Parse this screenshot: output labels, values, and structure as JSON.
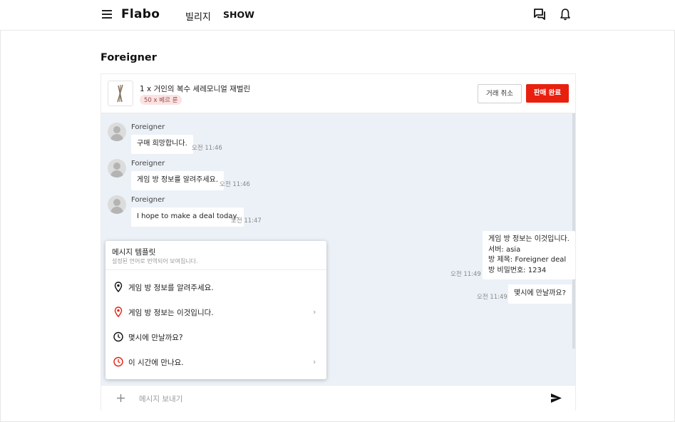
{
  "header": {
    "logo": "Flabo",
    "nav": [
      "빌리지",
      "SHOW"
    ]
  },
  "page": {
    "title": "Foreigner"
  },
  "product": {
    "name": "1 x 거인의 복수 세레모니얼 재벌린",
    "price_badge": "50 x 베르 룬",
    "cancel_label": "거래 취소",
    "complete_label": "판매 완료"
  },
  "messages": [
    {
      "sender": "Foreigner",
      "text": "구매 희망합니다.",
      "time": "오전 11:46"
    },
    {
      "sender": "Foreigner",
      "text": "게임 방 정보를 알려주세요.",
      "time": "오전 11:46"
    },
    {
      "sender": "Foreigner",
      "text": "I hope to make a deal today.",
      "time": "오전 11:47"
    }
  ],
  "my_messages": [
    {
      "lines": [
        "게임 방 정보는 이것입니다.",
        "서버: asia",
        "방 제목: Foreigner deal",
        "방 비밀번호: 1234"
      ],
      "time": "오전 11:49"
    },
    {
      "lines": [
        "몇시에 만날까요?"
      ],
      "time": "오전 11:49"
    }
  ],
  "template_popup": {
    "title": "메시지 템플릿",
    "subtitle": "설정된 언어로 번역되어 보여집니다.",
    "items": [
      {
        "icon": "pin-icon",
        "label": "게임 방 정보를 알려주세요.",
        "has_submenu": false
      },
      {
        "icon": "pin-icon-red",
        "label": "게임 방 정보는 이것입니다.",
        "has_submenu": true
      },
      {
        "icon": "clock-icon",
        "label": "몇시에 만날까요?",
        "has_submenu": false
      },
      {
        "icon": "clock-icon-red",
        "label": "이 시간에 만나요.",
        "has_submenu": true
      }
    ]
  },
  "input": {
    "placeholder": "메시지 보내기"
  },
  "colors": {
    "accent": "#e8210e",
    "chat_bg": "#ebf1f7"
  }
}
